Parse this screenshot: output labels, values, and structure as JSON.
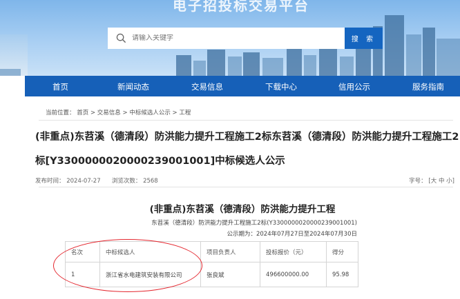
{
  "banner": {
    "site_title": "电子招投标交易平台",
    "search": {
      "placeholder": "请输入关键字",
      "button_label": "搜 索"
    }
  },
  "nav": {
    "items": [
      "首页",
      "新闻动态",
      "交易信息",
      "下载中心",
      "信用公示",
      "服务指南"
    ]
  },
  "breadcrumb": {
    "prefix": "当前位置：",
    "items": [
      "首页",
      "交易信息",
      "中标候选人公示",
      "工程"
    ],
    "separator": ">"
  },
  "article": {
    "title": "(非重点)东苕溪（德清段）防洪能力提升工程施工2标东苕溪（德清段）防洪能力提升工程施工2标[Y3300000020000239001001]中标候选人公示",
    "publish_time_label": "发布时间：",
    "publish_time": "2024-07-27",
    "views_label": "浏览次数：",
    "views": "2568",
    "font_size_label": "字号：",
    "font_size_options": [
      "大",
      "中",
      "小"
    ]
  },
  "document": {
    "heading": "(非重点)东苕溪（德清段）防洪能力提升工程",
    "subheading": "东苕溪（德清段）防洪能力提升工程施工2标(Y3300000020000239001001)",
    "period": "公示期为：2024年07月27日至2024年07月30日",
    "table": {
      "headers": [
        "名次",
        "中标候选人",
        "项目负责人",
        "投标报价（元）",
        "得分"
      ],
      "rows": [
        [
          "1",
          "浙江省水电建筑安装有限公司",
          "张良斌",
          "496600000.00",
          "95.98"
        ]
      ]
    }
  },
  "colors": {
    "nav_bg": "#1660b8",
    "search_button": "#1565c0",
    "annotation": "#e4252d"
  }
}
